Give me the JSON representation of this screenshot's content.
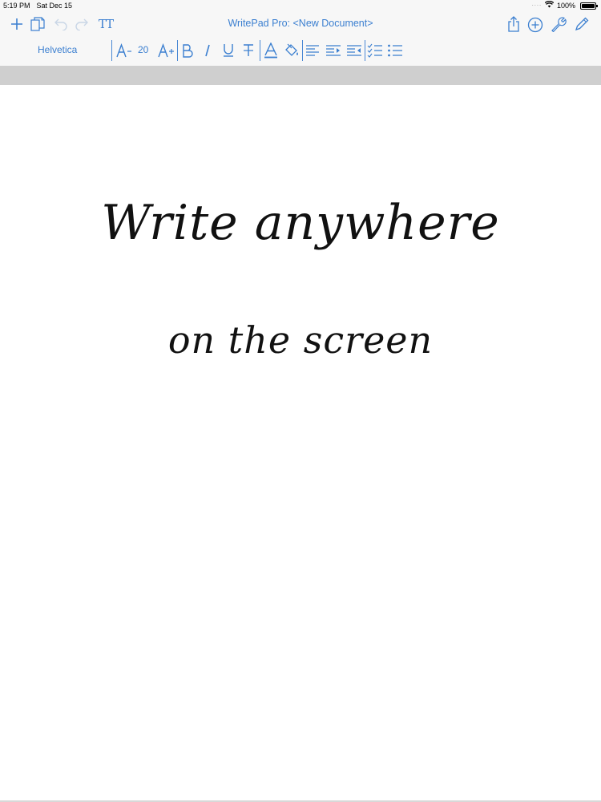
{
  "status_bar": {
    "time": "5:19 PM",
    "date": "Sat Dec 15",
    "battery": "100%",
    "battery_level": 1.0
  },
  "toolbar": {
    "document_title": "WritePad Pro: <New Document>",
    "font_name": "Helvetica",
    "font_size": "20",
    "text_size_icon": "TT",
    "icons": {
      "new": "plus-icon",
      "documents": "documents-icon",
      "undo": "undo-icon",
      "redo": "redo-icon",
      "text_style": "text-size-icon",
      "share": "share-icon",
      "add": "add-circle-icon",
      "settings": "wrench-icon",
      "pen": "pen-icon",
      "decrease_font": "decrease-font-icon",
      "increase_font": "increase-font-icon",
      "bold": "bold-icon",
      "italic": "italic-icon",
      "underline": "underline-icon",
      "strikethrough": "strikethrough-icon",
      "text_color": "text-color-icon",
      "fill_color": "fill-color-icon",
      "align_left": "align-left-icon",
      "indent": "indent-icon",
      "outdent": "outdent-icon",
      "checklist": "checklist-icon",
      "bullet_list": "bullet-list-icon"
    },
    "accent_color": "#3b7fd0",
    "disabled_color": "#c9d6e6"
  },
  "canvas": {
    "lines": [
      "Write anywhere",
      "on the screen"
    ],
    "background": "#ffffff",
    "band_color": "#cfcfcf"
  }
}
